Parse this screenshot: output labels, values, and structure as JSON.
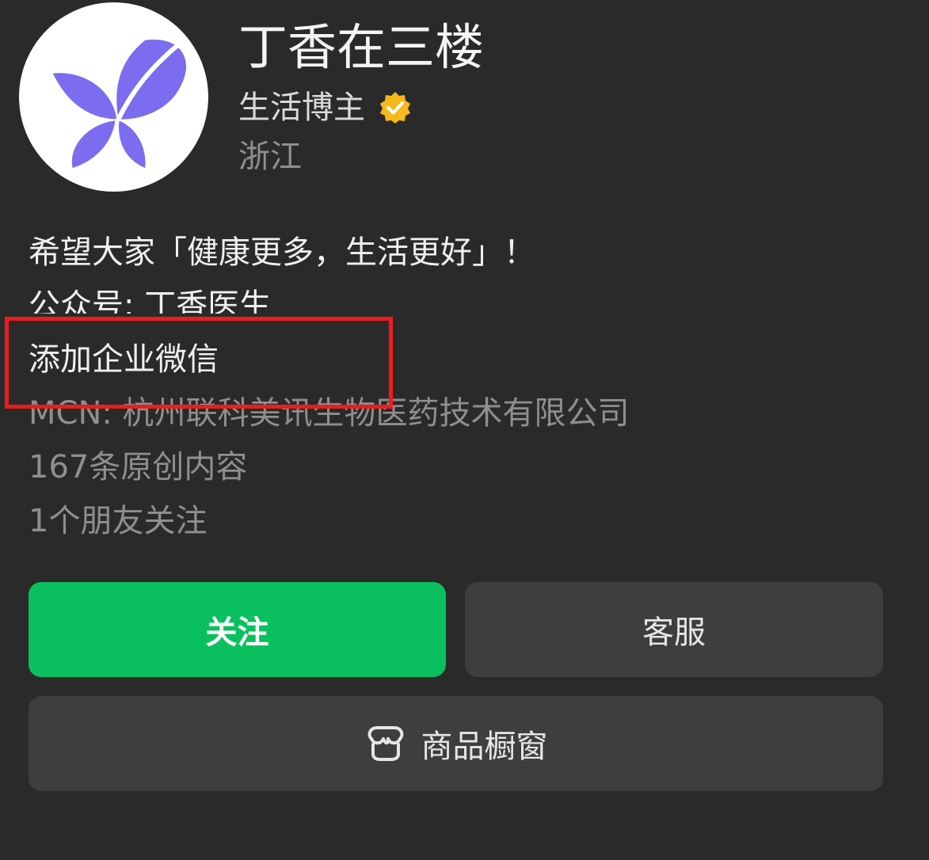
{
  "profile": {
    "name": "丁香在三楼",
    "category": "生活博主",
    "location": "浙江",
    "icons": {
      "avatar": "butterfly-leaf-logo",
      "verified": "verified-badge-icon"
    },
    "colors": {
      "logo": "#7b6cf0",
      "verified": "#f6b81c"
    }
  },
  "info": {
    "slogan": "希望大家「健康更多，生活更好」！",
    "official_account": "公众号: 丁香医生",
    "add_wechat": "添加企业微信",
    "mcn": "MCN: 杭州联科美讯生物医药技术有限公司",
    "original_count": "167条原创内容",
    "friends_following": "1个朋友关注"
  },
  "actions": {
    "follow": "关注",
    "service": "客服",
    "shop": "商品橱窗",
    "shop_icon": "storefront-icon"
  },
  "theme": {
    "background": "#2a2a2a",
    "follow_button": "#0ac05e",
    "secondary_button": "#3e3e3e",
    "highlight": "#ee1c1c"
  }
}
